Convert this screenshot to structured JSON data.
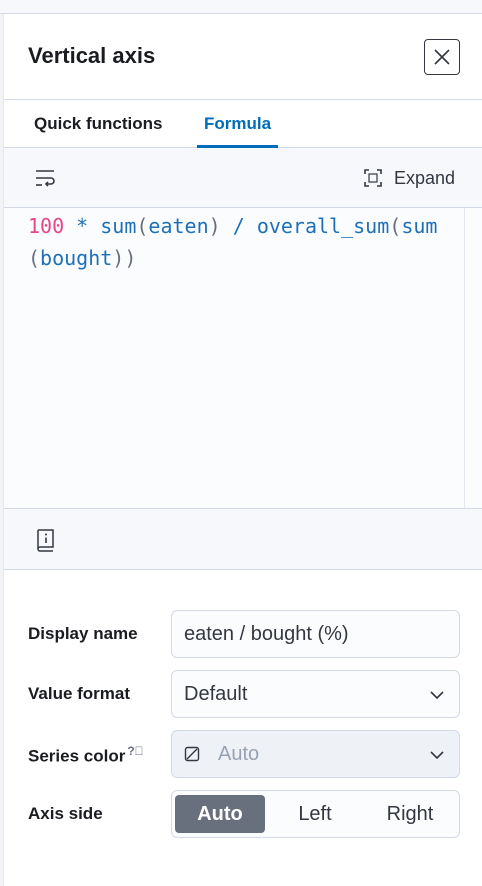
{
  "flyout": {
    "title": "Vertical axis",
    "close_icon": "close-icon"
  },
  "tabs": [
    {
      "label": "Quick functions",
      "active": false
    },
    {
      "label": "Formula",
      "active": true
    }
  ],
  "editor": {
    "wrap_icon": "word-wrap-icon",
    "expand_label": "Expand",
    "expand_icon": "fullscreen-icon",
    "formula_tokens": {
      "number": "100",
      "op_mul": " * ",
      "fn_sum": "sum",
      "open1": "(",
      "arg_eaten": "eaten",
      "close1": ")",
      "op_div": " / ",
      "fn_overall": "overall_sum",
      "open2": "(",
      "fn_sum2": "sum",
      "open3": "(",
      "arg_bought": "bought",
      "close3": "))"
    },
    "docs_icon": "documentation-icon"
  },
  "form": {
    "display_name": {
      "label": "Display name",
      "value": "eaten / bought (%)"
    },
    "value_format": {
      "label": "Value format",
      "value": "Default"
    },
    "series_color": {
      "label": "Series color",
      "value": "Auto",
      "help_icon": "question-icon",
      "disabled": true
    },
    "axis_side": {
      "label": "Axis side",
      "options": [
        "Auto",
        "Left",
        "Right"
      ],
      "selected": "Auto"
    }
  },
  "colors": {
    "accent": "#006bb8",
    "number_token": "#e8468b",
    "segment_active": "#69707d"
  }
}
